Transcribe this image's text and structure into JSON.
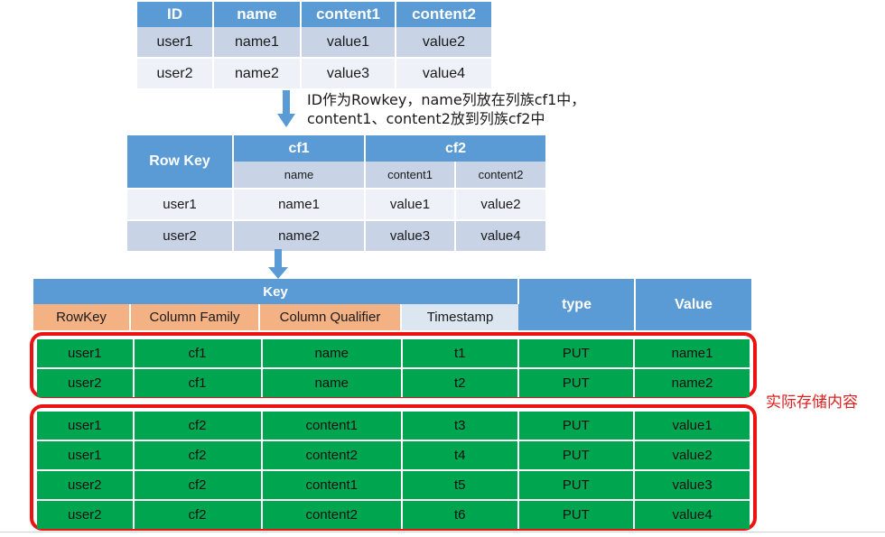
{
  "diagram": {
    "title": "HBase data model mapping",
    "colors": {
      "header_blue": "#5b9bd5",
      "row_light": "#eef2f8",
      "row_alt": "#c8d4e6",
      "orange": "#f4b183",
      "timestamp_blue": "#dce6f1",
      "green": "#00a550",
      "highlight_red": "#ee1111",
      "annotation_red": "#d92121"
    }
  },
  "table1": {
    "name": "source-relational-table",
    "headers": [
      "ID",
      "name",
      "content1",
      "content2"
    ],
    "rows": [
      [
        "user1",
        "name1",
        "value1",
        "value2"
      ],
      [
        "user2",
        "name2",
        "value3",
        "value4"
      ]
    ]
  },
  "arrow1": {
    "icon": "arrow-down-icon",
    "caption": "ID作为Rowkey，name列放在列族cf1中，\ncontent1、content2放到列族cf2中"
  },
  "table2": {
    "name": "column-family-table",
    "rowkey_header": "Row Key",
    "family_headers": [
      {
        "label": "cf1",
        "span": 1
      },
      {
        "label": "cf2",
        "span": 2
      }
    ],
    "qualifier_headers": [
      "name",
      "content1",
      "content2"
    ],
    "rows": [
      [
        "user1",
        "name1",
        "value1",
        "value2"
      ],
      [
        "user2",
        "name2",
        "value3",
        "value4"
      ]
    ]
  },
  "arrow2": {
    "icon": "arrow-down-icon"
  },
  "table3": {
    "name": "keyvalue-storage-table",
    "group_header": "Key",
    "right_headers": [
      "type",
      "Value"
    ],
    "sub_headers": [
      "RowKey",
      "Column Family",
      "Column Qualifier",
      "Timestamp"
    ],
    "block1": {
      "rows": [
        [
          "user1",
          "cf1",
          "name",
          "t1",
          "PUT",
          "name1"
        ],
        [
          "user2",
          "cf1",
          "name",
          "t2",
          "PUT",
          "name2"
        ]
      ]
    },
    "block2": {
      "rows": [
        [
          "user1",
          "cf2",
          "content1",
          "t3",
          "PUT",
          "value1"
        ],
        [
          "user1",
          "cf2",
          "content2",
          "t4",
          "PUT",
          "value2"
        ],
        [
          "user2",
          "cf2",
          "content1",
          "t5",
          "PUT",
          "value3"
        ],
        [
          "user2",
          "cf2",
          "content2",
          "t6",
          "PUT",
          "value4"
        ]
      ]
    }
  },
  "annotation": {
    "text": "实际存储内容"
  }
}
